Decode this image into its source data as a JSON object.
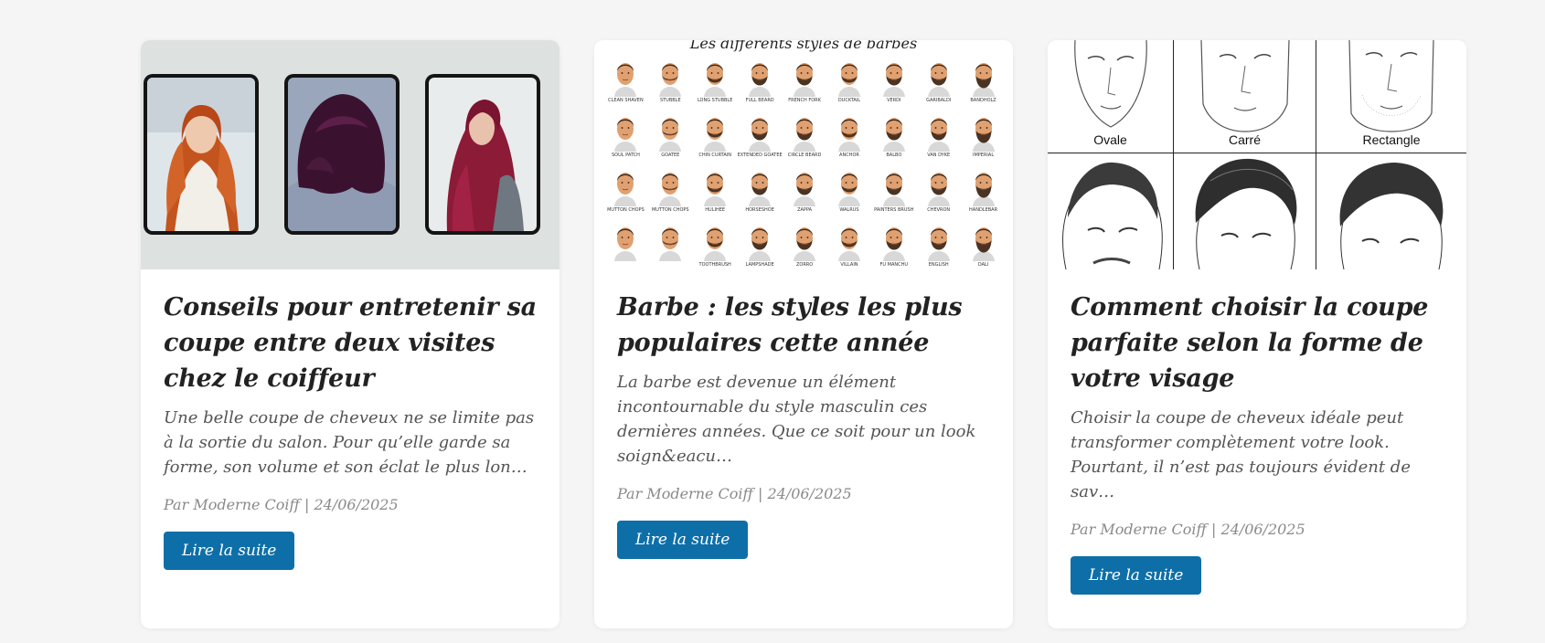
{
  "cards": [
    {
      "title": "Conseils pour entretenir sa coupe entre deux visites chez le coiffeur",
      "excerpt": "Une belle coupe de cheveux ne se limite pas à la sortie du salon. Pour qu’elle garde sa forme, son volume et son éclat le plus lon…",
      "meta": "Par Moderne Coiff | 24/06/2025",
      "button": "Lire la suite"
    },
    {
      "title": "Barbe : les styles les plus populaires cette année",
      "excerpt": "La barbe est devenue un élément incontournable du style masculin ces dernières années. Que ce soit pour un look soign&eacu…",
      "meta": "Par Moderne Coiff | 24/06/2025",
      "button": "Lire la suite"
    },
    {
      "title": "Comment choisir la coupe parfaite selon la forme de votre visage",
      "excerpt": "Choisir la coupe de cheveux idéale peut transformer complètement votre look. Pourtant, il n’est pas toujours évident de sav…",
      "meta": "Par Moderne Coiff | 24/06/2025",
      "button": "Lire la suite"
    }
  ],
  "beard_image": {
    "title": "Les différents styles de barbes",
    "styles": [
      "CLEAN SHAVEN",
      "STUBBLE",
      "LONG STUBBLE",
      "FULL BEARD",
      "FRENCH FORK",
      "DUCKTAIL",
      "VERDI",
      "GARIBALDI",
      "BANDHOLZ",
      "SOUL PATCH",
      "GOATEE",
      "CHIN CURTAIN",
      "EXTENDED GOATEE",
      "CIRCLE BEARD",
      "ANCHOR",
      "BALBO",
      "VAN DYKE",
      "IMPERIAL",
      "MUTTON CHOPS",
      "MUTTON CHOPS",
      "HULIHEE",
      "HORSESHOE",
      "ZAPPA",
      "WALRUS",
      "PAINTERS BRUSH",
      "CHEVRON",
      "HANDLEBAR",
      "",
      "",
      "TOOTHBRUSH",
      "LAMPSHADE",
      "ZORRO",
      "VILLAIN",
      "FU MANCHU",
      "ENGLISH",
      "DALI"
    ]
  },
  "face_image": {
    "shapes": [
      "Ovale",
      "Carré",
      "Rectangle"
    ]
  },
  "colors": {
    "button": "#0e6fa8",
    "background": "#f5f5f5"
  }
}
